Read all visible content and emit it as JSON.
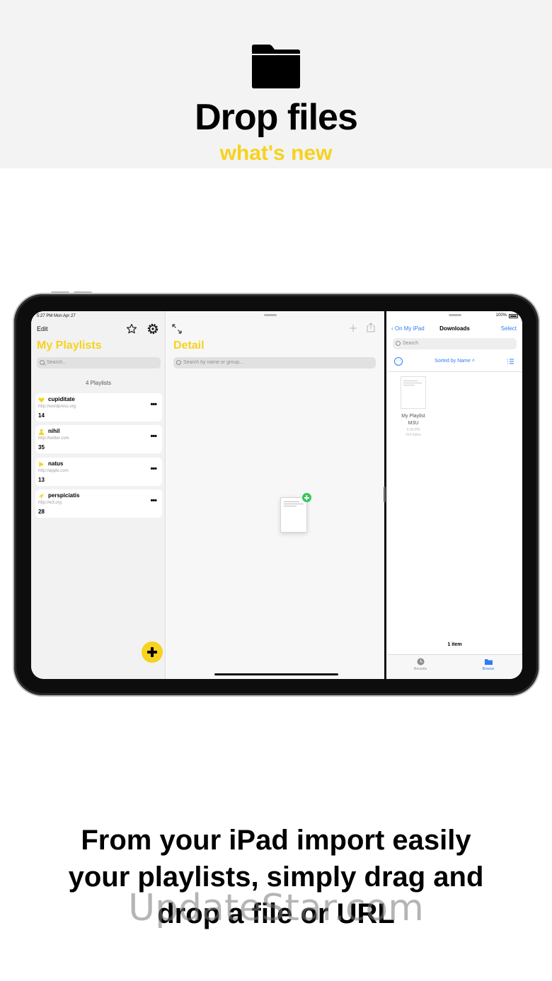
{
  "hero": {
    "folder_icon": "folder-icon",
    "title": "Drop files",
    "subtitle": "what's new",
    "accent_color": "#f7d21e"
  },
  "ipad": {
    "left": {
      "status": "5:27 PM   Mon Apr 27",
      "edit": "Edit",
      "title": "My Playlists",
      "search_placeholder": "Search...",
      "count": "4 Playlists",
      "playlists": [
        {
          "name": "cupiditate",
          "url": "http://wordpress.org",
          "count": "14",
          "icon": "heart-icon",
          "more": "•••"
        },
        {
          "name": "nihil",
          "url": "http://twitter.com",
          "count": "35",
          "icon": "person-icon",
          "more": "•••"
        },
        {
          "name": "natus",
          "url": "http://apple.com",
          "count": "13",
          "icon": "play-icon",
          "more": "•••"
        },
        {
          "name": "perspiciatis",
          "url": "http://w3.org",
          "count": "28",
          "icon": "airplane-icon",
          "more": "•••"
        }
      ]
    },
    "middle": {
      "title": "Detail",
      "search_placeholder": "Search by name or group..."
    },
    "right": {
      "status": "100%",
      "back": "On My iPad",
      "title": "Downloads",
      "select": "Select",
      "search_placeholder": "Search",
      "sorted": "Sorted by Name",
      "file": {
        "name_line1": "My Playlist",
        "name_line2": "M3U",
        "time": "5:26 PM",
        "size": "414 bytes"
      },
      "item_count": "1 item",
      "tabs": [
        {
          "label": "Recents",
          "icon": "clock-icon",
          "color": "#8e8e93"
        },
        {
          "label": "Browse",
          "icon": "folder-icon",
          "color": "#2f7cf6"
        }
      ]
    }
  },
  "caption": {
    "line1": "From your iPad import easily",
    "line2": "your playlists, simply drag and",
    "line3": "drop a file or URL"
  },
  "watermark": "UpdateStar.com"
}
